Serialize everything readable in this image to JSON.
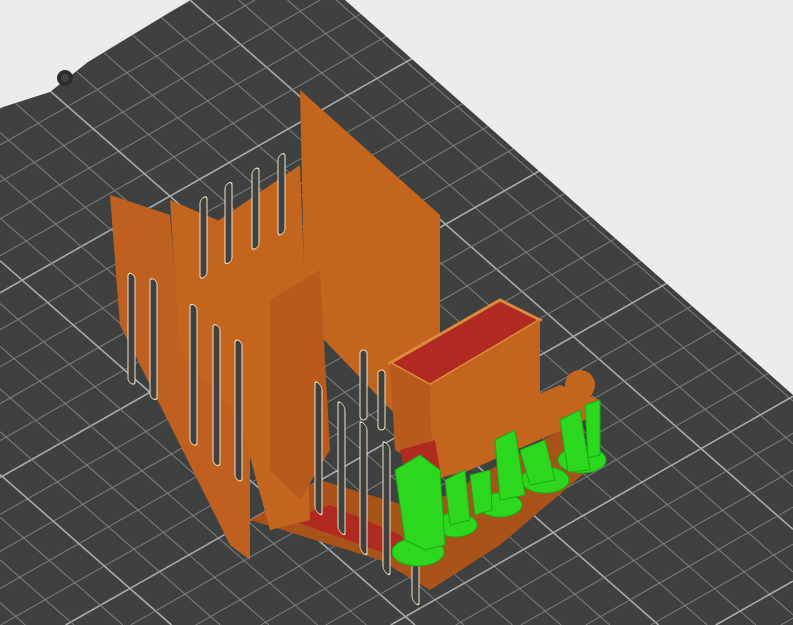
{
  "viewport": {
    "view": "3d-slice-preview",
    "colors": {
      "background": "#ececec",
      "bed": "#3f4140",
      "grid": "#8a8c8b",
      "perimeter": "#c4651e",
      "infill": "#b02a22",
      "support": "#2bd81e"
    }
  }
}
